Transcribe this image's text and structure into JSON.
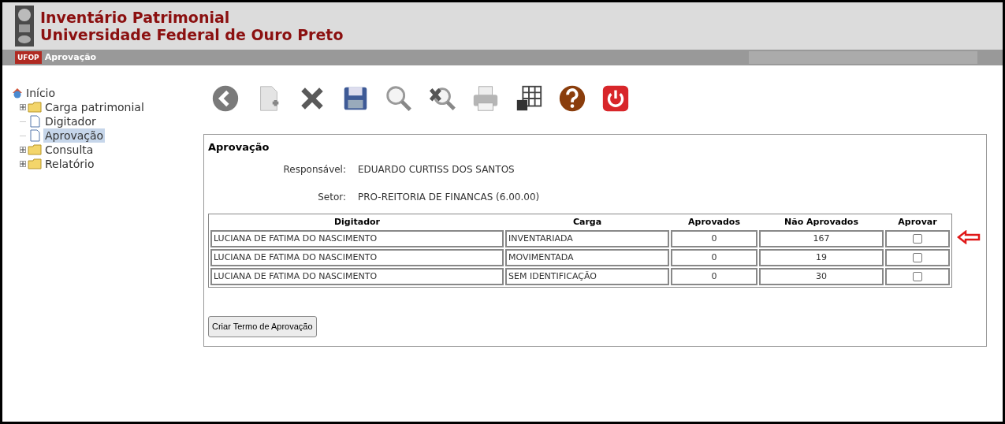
{
  "header": {
    "title": "Inventário Patrimonial",
    "subtitle": "Universidade Federal de Ouro Preto"
  },
  "nav_bar": {
    "badge": "UFOP",
    "title": "Aprovação"
  },
  "tree": [
    {
      "label": "Início",
      "kind": "home",
      "selected": false
    },
    {
      "label": "Carga patrimonial",
      "kind": "folder",
      "selected": false,
      "expandable": true
    },
    {
      "label": "Digitador",
      "kind": "page",
      "selected": false
    },
    {
      "label": "Aprovação",
      "kind": "page",
      "selected": true
    },
    {
      "label": "Consulta",
      "kind": "folder",
      "selected": false,
      "expandable": true
    },
    {
      "label": "Relatório",
      "kind": "folder",
      "selected": false,
      "expandable": true
    }
  ],
  "toolbar": [
    {
      "kind": "back"
    },
    {
      "kind": "new"
    },
    {
      "kind": "delete"
    },
    {
      "kind": "save"
    },
    {
      "kind": "search"
    },
    {
      "kind": "clear-search"
    },
    {
      "kind": "print"
    },
    {
      "kind": "grid"
    },
    {
      "kind": "help"
    },
    {
      "kind": "exit"
    }
  ],
  "panel": {
    "title": "Aprovação",
    "fields": [
      {
        "label": "Responsável:",
        "value": "EDUARDO CURTISS DOS SANTOS"
      },
      {
        "label": "Setor:",
        "value": "PRO-REITORIA DE FINANCAS (6.00.00)"
      }
    ],
    "table": {
      "columns": [
        "Digitador",
        "Carga",
        "Aprovados",
        "Não Aprovados",
        "Aprovar"
      ],
      "rows": [
        {
          "digitador": "LUCIANA DE FATIMA DO NASCIMENTO",
          "carga": "INVENTARIADA",
          "aprovados": "0",
          "nao_aprovados": "167",
          "checked": false,
          "marked": true
        },
        {
          "digitador": "LUCIANA DE FATIMA DO NASCIMENTO",
          "carga": "MOVIMENTADA",
          "aprovados": "0",
          "nao_aprovados": "19",
          "checked": false,
          "marked": false
        },
        {
          "digitador": "LUCIANA DE FATIMA DO NASCIMENTO",
          "carga": "SEM IDENTIFICAÇÃO",
          "aprovados": "0",
          "nao_aprovados": "30",
          "checked": false,
          "marked": false
        }
      ]
    },
    "button": "Criar Termo de Aprovação"
  }
}
